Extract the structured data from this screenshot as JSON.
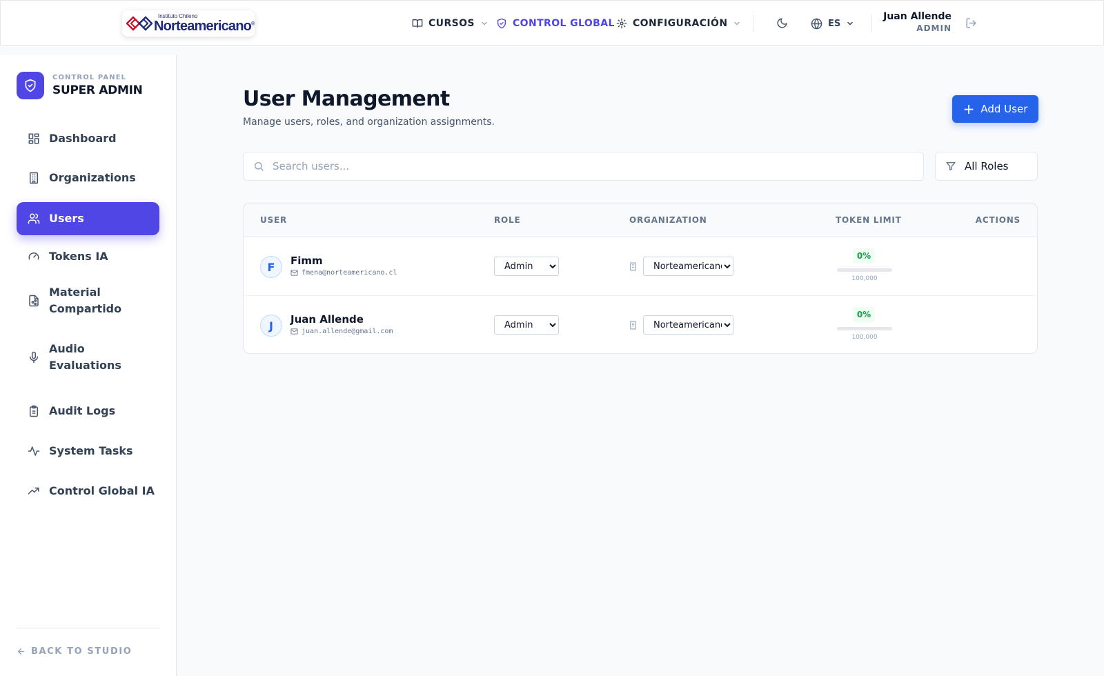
{
  "colors": {
    "accent": "#4f46e5",
    "primary_button": "#2563eb",
    "success": "#16a34a",
    "background": "#f8fafc"
  },
  "header": {
    "logo": {
      "small_text": "Instituto Chileno",
      "big_text": "Norteamericano"
    },
    "nav": [
      {
        "label": "CURSOS",
        "icon": "book-open-icon",
        "has_dropdown": true
      },
      {
        "label": "CONTROL GLOBAL",
        "icon": "shield-check-icon",
        "active": true
      },
      {
        "label": "CONFIGURACIÓN",
        "icon": "gear-icon",
        "has_dropdown": true
      }
    ],
    "theme_icon": "moon-icon",
    "language": {
      "icon": "globe-icon",
      "value": "ES"
    },
    "user": {
      "name": "Juan Allende",
      "role": "ADMIN"
    },
    "logout_icon": "logout-icon"
  },
  "sidebar": {
    "brand": {
      "subtitle": "CONTROL PANEL",
      "title": "SUPER ADMIN",
      "icon": "shield-check-icon"
    },
    "items": [
      {
        "label": "Dashboard",
        "icon": "dashboard-icon"
      },
      {
        "label": "Organizations",
        "icon": "building-icon"
      },
      {
        "label": "Users",
        "icon": "users-icon",
        "active": true
      },
      {
        "label": "Tokens IA",
        "icon": "gauge-icon"
      },
      {
        "label": "Material Compartido",
        "icon": "file-share-icon"
      },
      {
        "label": "Audio Evaluations",
        "icon": "microphone-icon"
      },
      {
        "label": "Audit Logs",
        "icon": "clipboard-icon"
      },
      {
        "label": "System Tasks",
        "icon": "activity-icon"
      },
      {
        "label": "Control Global IA",
        "icon": "trending-up-icon"
      }
    ],
    "back_label": "BACK TO STUDIO"
  },
  "main": {
    "title": "User Management",
    "subtitle": "Manage users, roles, and organization assignments.",
    "add_button": "Add User",
    "search": {
      "placeholder": "Search users...",
      "value": ""
    },
    "role_filter": "All Roles",
    "table": {
      "columns": [
        "USER",
        "ROLE",
        "ORGANIZATION",
        "TOKEN LIMIT",
        "ACTIONS"
      ],
      "rows": [
        {
          "initial": "F",
          "name": "Fimm",
          "email": "fmena@norteamericano.cl",
          "role": "Admin",
          "organization": "Norteamericano",
          "token_usage": "0%",
          "token_usage_fraction": 0,
          "token_limit": "100,000"
        },
        {
          "initial": "J",
          "name": "Juan Allende",
          "email": "juan.allende@gmail.com",
          "role": "Admin",
          "organization": "Norteamericano",
          "token_usage": "0%",
          "token_usage_fraction": 0,
          "token_limit": "100,000"
        }
      ]
    }
  }
}
